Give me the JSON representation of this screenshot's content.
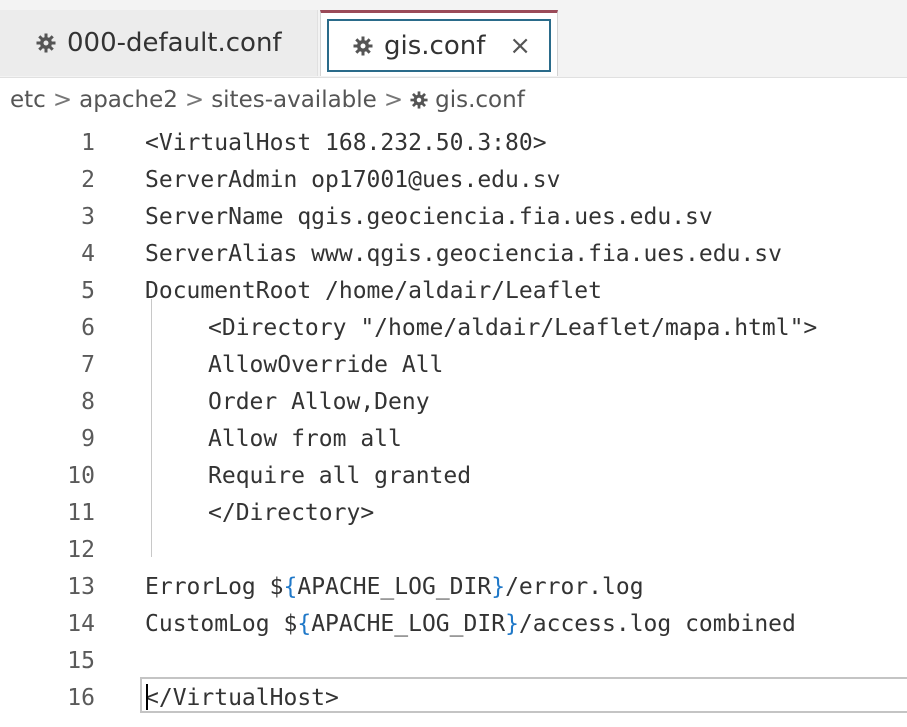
{
  "tabs": [
    {
      "label": "000-default.conf",
      "icon": "gear-icon",
      "active": false
    },
    {
      "label": "gis.conf",
      "icon": "gear-icon",
      "active": true,
      "close": "×"
    }
  ],
  "breadcrumb": {
    "parts": [
      "etc",
      "apache2",
      "sites-available"
    ],
    "separator": ">",
    "file": "gis.conf",
    "file_icon": "gear-icon"
  },
  "editor": {
    "lines": [
      {
        "num": "1",
        "text": "<VirtualHost 168.232.50.3:80>"
      },
      {
        "num": "2",
        "text": "ServerAdmin op17001@ues.edu.sv"
      },
      {
        "num": "3",
        "text": "ServerName qgis.geociencia.fia.ues.edu.sv"
      },
      {
        "num": "4",
        "text": "ServerAlias www.qgis.geociencia.fia.ues.edu.sv"
      },
      {
        "num": "5",
        "text": "DocumentRoot /home/aldair/Leaflet"
      },
      {
        "num": "6",
        "text": "<Directory \"/home/aldair/Leaflet/mapa.html\">"
      },
      {
        "num": "7",
        "text": "AllowOverride All"
      },
      {
        "num": "8",
        "text": "Order Allow,Deny"
      },
      {
        "num": "9",
        "text": "Allow from all"
      },
      {
        "num": "10",
        "text": "Require all granted"
      },
      {
        "num": "11",
        "text": "</Directory>"
      },
      {
        "num": "12",
        "text": ""
      },
      {
        "num": "13",
        "pre": "ErrorLog $",
        "open": "{",
        "var": "APACHE_LOG_DIR",
        "close": "}",
        "post": "/error.log"
      },
      {
        "num": "14",
        "pre": "CustomLog $",
        "open": "{",
        "var": "APACHE_LOG_DIR",
        "close": "}",
        "post": "/access.log combined"
      },
      {
        "num": "15",
        "text": ""
      },
      {
        "num": "16",
        "text": "</VirtualHost>"
      }
    ]
  },
  "colors": {
    "active_tab_top": "#9b4a58",
    "focus_border": "#2a6b8a",
    "brace": "#1f78c8"
  }
}
